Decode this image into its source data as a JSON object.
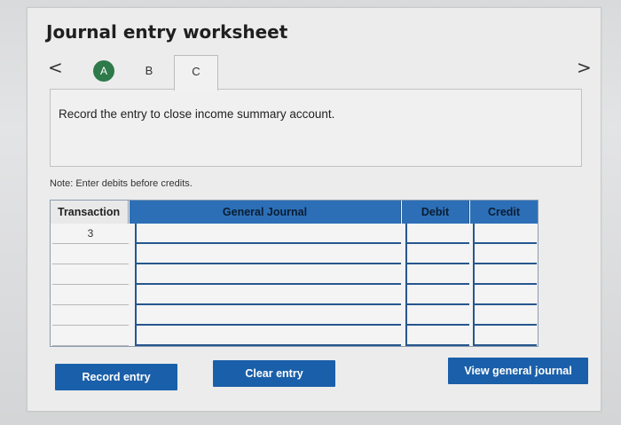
{
  "worksheet": {
    "title": "Journal entry worksheet",
    "nav_prev": "<",
    "nav_next": ">",
    "tabs": [
      {
        "label": "A",
        "status": "completed",
        "color": "#2e7a4a"
      },
      {
        "label": "B",
        "status": "pending"
      },
      {
        "label": "C",
        "status": "active"
      }
    ],
    "prompt": "Record the entry to close income summary account.",
    "note": "Note: Enter debits before credits."
  },
  "table": {
    "headers": {
      "transaction": "Transaction",
      "general_journal": "General Journal",
      "debit": "Debit",
      "credit": "Credit"
    },
    "header_color": "#2c6fb7",
    "rows": [
      {
        "transaction": "3",
        "account": "",
        "debit": "",
        "credit": ""
      },
      {
        "transaction": "",
        "account": "",
        "debit": "",
        "credit": ""
      },
      {
        "transaction": "",
        "account": "",
        "debit": "",
        "credit": ""
      },
      {
        "transaction": "",
        "account": "",
        "debit": "",
        "credit": ""
      },
      {
        "transaction": "",
        "account": "",
        "debit": "",
        "credit": ""
      },
      {
        "transaction": "",
        "account": "",
        "debit": "",
        "credit": ""
      }
    ]
  },
  "buttons": {
    "record": "Record entry",
    "clear": "Clear entry",
    "view": "View general journal",
    "color": "#1a5fa9"
  }
}
